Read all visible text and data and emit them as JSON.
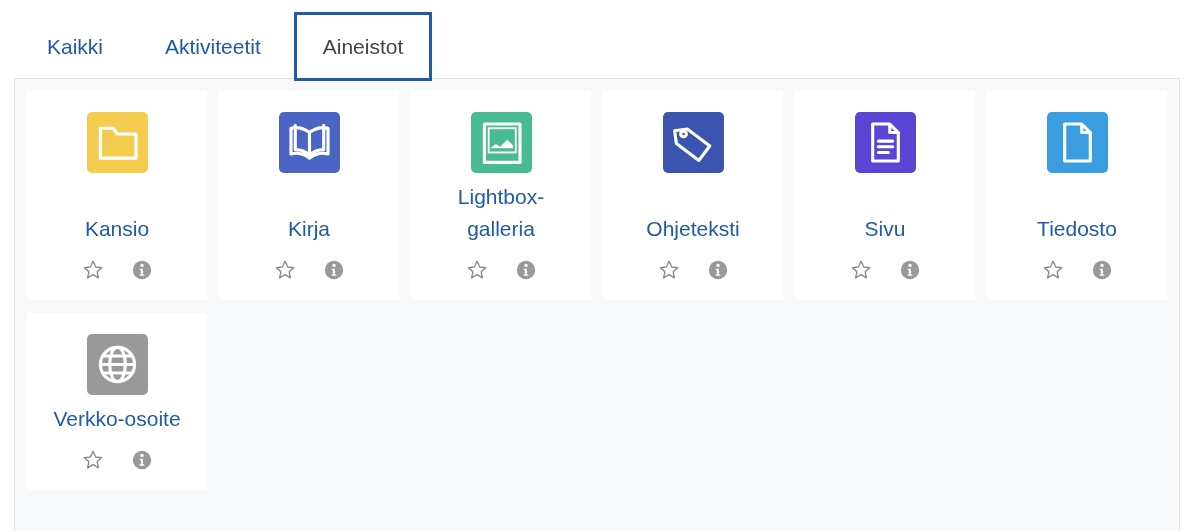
{
  "tabs": [
    {
      "label": "Kaikki",
      "selected": false
    },
    {
      "label": "Aktiviteetit",
      "selected": false
    },
    {
      "label": "Aineistot",
      "selected": true
    }
  ],
  "modules": [
    {
      "name": "Kansio",
      "kind": "folder",
      "color": "#f5cd4e",
      "starred": false
    },
    {
      "name": "Kirja",
      "kind": "book",
      "color": "#4a65c3",
      "starred": false
    },
    {
      "name": "Lightbox-galleria",
      "kind": "image",
      "color": "#47bb91",
      "starred": false
    },
    {
      "name": "Ohjeteksti",
      "kind": "tag",
      "color": "#3a55b0",
      "starred": false
    },
    {
      "name": "Sivu",
      "kind": "page",
      "color": "#5a45d5",
      "starred": false
    },
    {
      "name": "Tiedosto",
      "kind": "file",
      "color": "#3a9de0",
      "starred": false
    },
    {
      "name": "Verkko-osoite",
      "kind": "globe",
      "color": "#999999",
      "starred": false
    }
  ]
}
